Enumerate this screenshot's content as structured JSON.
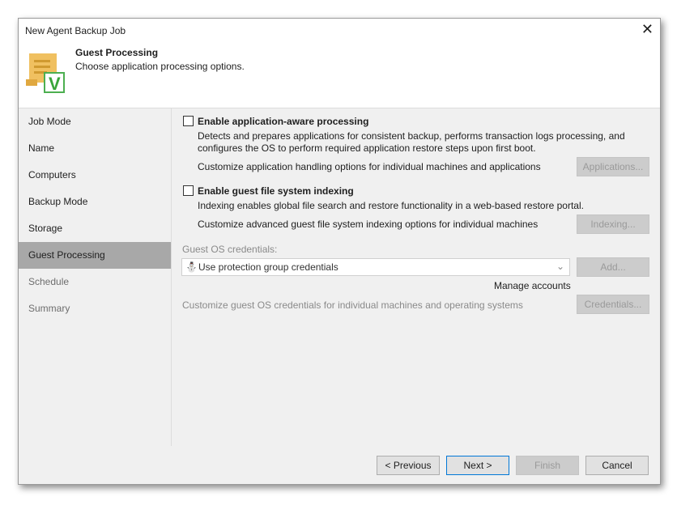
{
  "window": {
    "title": "New Agent Backup Job"
  },
  "header": {
    "title": "Guest Processing",
    "subtitle": "Choose application processing options."
  },
  "sidebar": {
    "items": [
      {
        "label": "Job Mode"
      },
      {
        "label": "Name"
      },
      {
        "label": "Computers"
      },
      {
        "label": "Backup Mode"
      },
      {
        "label": "Storage"
      },
      {
        "label": "Guest Processing"
      },
      {
        "label": "Schedule"
      },
      {
        "label": "Summary"
      }
    ]
  },
  "main": {
    "app_aware": {
      "label": "Enable application-aware processing",
      "desc1": "Detects and prepares applications for consistent backup, performs transaction logs processing, and",
      "desc2": "configures the OS to perform required application restore steps upon first boot.",
      "customize": "Customize application handling options for individual machines and applications",
      "button": "Applications..."
    },
    "indexing": {
      "label": "Enable guest file system indexing",
      "desc": "Indexing enables global file search and restore functionality in a web-based restore portal.",
      "customize": "Customize advanced guest file system indexing options for individual machines",
      "button": "Indexing..."
    },
    "credentials": {
      "label": "Guest OS credentials:",
      "value": "Use protection group credentials",
      "add": "Add...",
      "manage": "Manage accounts",
      "customize": "Customize guest OS credentials for individual machines and operating systems",
      "button": "Credentials..."
    }
  },
  "footer": {
    "previous": "< Previous",
    "next": "Next >",
    "finish": "Finish",
    "cancel": "Cancel"
  }
}
